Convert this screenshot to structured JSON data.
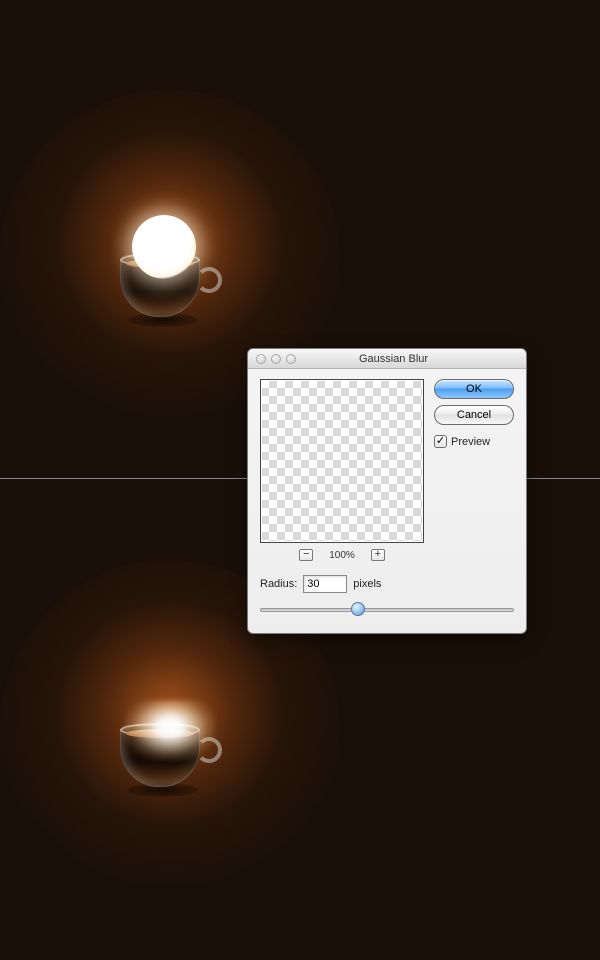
{
  "dialog": {
    "title": "Gaussian Blur",
    "ok_label": "OK",
    "cancel_label": "Cancel",
    "preview_label": "Preview",
    "preview_checked": true,
    "zoom": {
      "minus": "−",
      "plus": "+",
      "value": "100%"
    },
    "radius": {
      "label": "Radius:",
      "value": "30",
      "unit": "pixels"
    }
  },
  "checkmark": "✓"
}
